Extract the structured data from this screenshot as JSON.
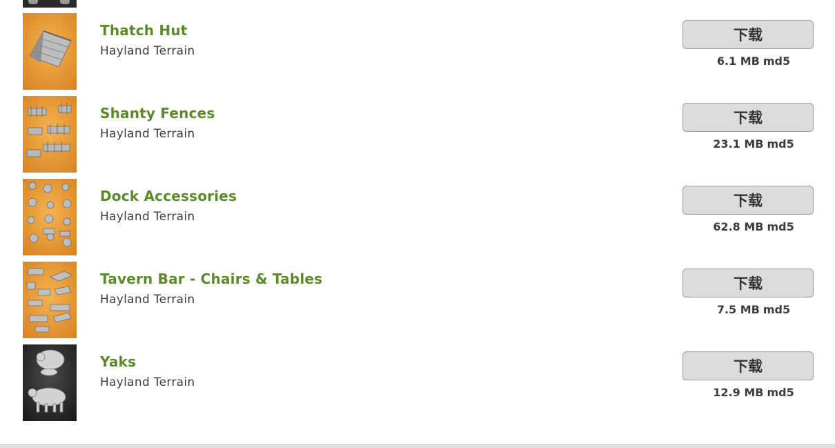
{
  "items": [
    {
      "title": "Thatch Hut",
      "subtitle": "Hayland Terrain",
      "button_label": "下载",
      "size": "6.1 MB",
      "md5_label": "md5",
      "thumb_icon": "thatch-hut-model",
      "thumb_bg": "orange"
    },
    {
      "title": "Shanty Fences",
      "subtitle": "Hayland Terrain",
      "button_label": "下载",
      "size": "23.1 MB",
      "md5_label": "md5",
      "thumb_icon": "fence-pieces",
      "thumb_bg": "orange"
    },
    {
      "title": "Dock Accessories",
      "subtitle": "Hayland Terrain",
      "button_label": "下载",
      "size": "62.8 MB",
      "md5_label": "md5",
      "thumb_icon": "dock-pieces",
      "thumb_bg": "orange"
    },
    {
      "title": "Tavern Bar - Chairs & Tables",
      "subtitle": "Hayland Terrain",
      "button_label": "下载",
      "size": "7.5 MB",
      "md5_label": "md5",
      "thumb_icon": "tavern-furniture",
      "thumb_bg": "orange"
    },
    {
      "title": "Yaks",
      "subtitle": "Hayland Terrain",
      "button_label": "下载",
      "size": "12.9 MB",
      "md5_label": "md5",
      "thumb_icon": "yak-miniatures",
      "thumb_bg": "dark"
    }
  ],
  "colors": {
    "title": "#5b8a2b",
    "subtitle": "#3c3c3c",
    "button_bg": "#dcdcdc",
    "button_border": "#9c9c9c",
    "thumb_orange": "#e89a3a",
    "thumb_dark": "#2b2b2b"
  }
}
